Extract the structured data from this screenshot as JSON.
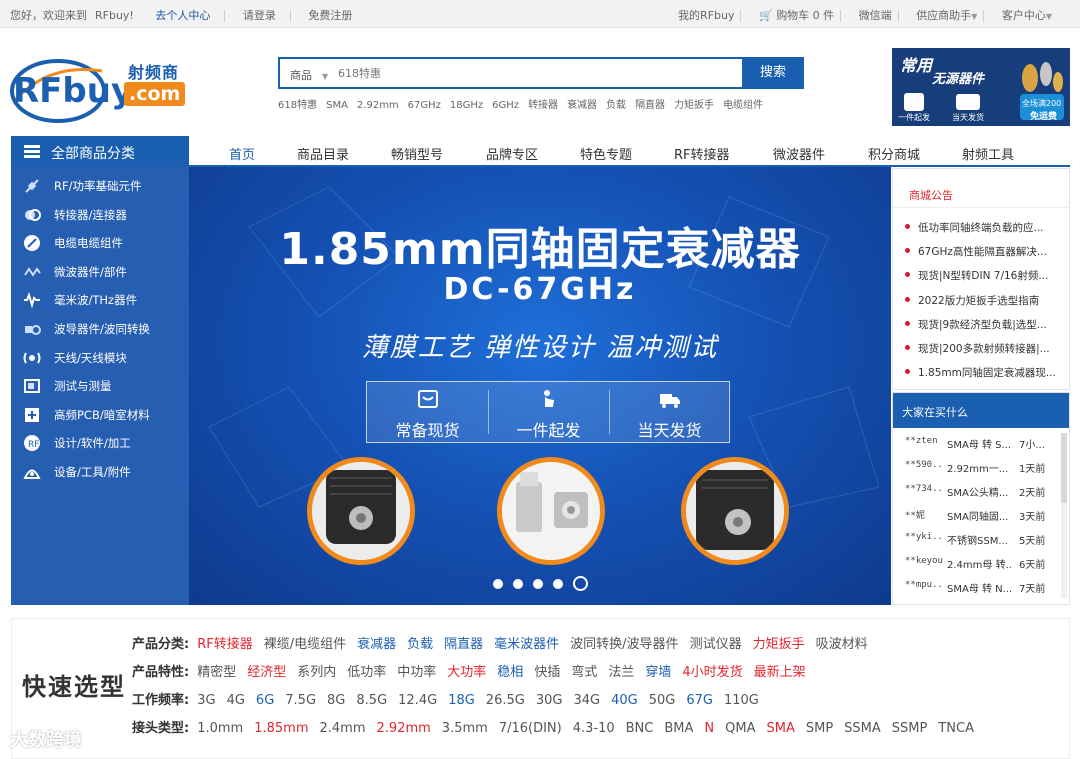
{
  "topbar": {
    "greeting": "您好，欢迎来到",
    "brand": "RFbuy!",
    "personal_center": "去个人中心",
    "login": "请登录",
    "register": "免费注册",
    "my_rfbuy": "我的RFbuy",
    "cart": "购物车 0 件",
    "wechat": "微信端",
    "supplier": "供应商助手",
    "customer_center": "客户中心"
  },
  "logo": {
    "main": "RFbuy",
    "com": ".com",
    "cn": "射频商城"
  },
  "search": {
    "category": "商品",
    "placeholder": "618特惠",
    "button": "搜索",
    "hotwords": [
      "618特惠",
      "SMA",
      "2.92mm",
      "67GHz",
      "18GHz",
      "6GHz",
      "转接器",
      "衰减器",
      "负载",
      "隔直器",
      "力矩扳手",
      "电缆组件"
    ]
  },
  "ad": {
    "line1": "常用",
    "line2": "无源器件",
    "badge1": "一件起发",
    "badge2": "当天发货",
    "promo1": "全场满200",
    "promo2": "免运费"
  },
  "catnav_label": "全部商品分类",
  "mainnav": [
    "首页",
    "商品目录",
    "畅销型号",
    "品牌专区",
    "特色专题",
    "RF转接器",
    "微波器件",
    "积分商城",
    "射频工具"
  ],
  "sidebar": [
    {
      "label": "RF/功率基础元件",
      "icon": "resistor-icon"
    },
    {
      "label": "转接器/连接器",
      "icon": "connector-icon"
    },
    {
      "label": "电缆电缆组件",
      "icon": "cable-icon"
    },
    {
      "label": "微波器件/部件",
      "icon": "microwave-icon"
    },
    {
      "label": "毫米波/THz器件",
      "icon": "wave-icon"
    },
    {
      "label": "波导器件/波同转换",
      "icon": "waveguide-icon"
    },
    {
      "label": "天线/天线模块",
      "icon": "antenna-icon"
    },
    {
      "label": "测试与测量",
      "icon": "instrument-icon"
    },
    {
      "label": "高频PCB/暗室材料",
      "icon": "pcb-icon"
    },
    {
      "label": "设计/软件/加工",
      "icon": "design-icon"
    },
    {
      "label": "设备/工具/附件",
      "icon": "tool-icon"
    }
  ],
  "banner": {
    "title": "1.85mm同轴固定衰减器",
    "freq": "DC-67GHz",
    "slogan": "薄膜工艺  弹性设计  温冲测试",
    "features": [
      "常备现货",
      "一件起发",
      "当天发货"
    ],
    "slides": 5,
    "active_slide": 5
  },
  "notice": {
    "title": "商城公告",
    "items": [
      "低功率同轴终端负载的应...",
      "67GHz高性能隔直器解决...",
      "现货|N型转DIN 7/16射频...",
      "2022版力矩扳手选型指南",
      "现货|9款经济型负载|选型...",
      "现货|200多款射频转接器|...",
      "1.85mm同轴固定衰减器现..."
    ]
  },
  "buying": {
    "title": "大家在买什么",
    "rows": [
      {
        "user": "**zten",
        "product": "SMA母 转 S...",
        "time": "7小..."
      },
      {
        "user": "**590...",
        "product": "2.92mm一...",
        "time": "1天前"
      },
      {
        "user": "**734...",
        "product": "SMA公头精...",
        "time": "2天前"
      },
      {
        "user": "**妮",
        "product": "SMA同轴固...",
        "time": "3天前"
      },
      {
        "user": "**yki...",
        "product": "不锈钢SSM...",
        "time": "5天前"
      },
      {
        "user": "**keyou",
        "product": "2.4mm母 转...",
        "time": "6天前"
      },
      {
        "user": "**mpu...",
        "product": "SMA母 转 N...",
        "time": "7天前"
      }
    ]
  },
  "quick": {
    "title": "快速选型",
    "rows": [
      {
        "label": "产品分类:",
        "items": [
          {
            "t": "RF转接器",
            "c": "red"
          },
          {
            "t": "裸缆/电缆组件",
            "c": ""
          },
          {
            "t": "衰减器",
            "c": "blue"
          },
          {
            "t": "负载",
            "c": "blue"
          },
          {
            "t": "隔直器",
            "c": "blue"
          },
          {
            "t": "毫米波器件",
            "c": "blue"
          },
          {
            "t": "波同转换/波导器件",
            "c": ""
          },
          {
            "t": "测试仪器",
            "c": ""
          },
          {
            "t": "力矩扳手",
            "c": "red"
          },
          {
            "t": "吸波材料",
            "c": ""
          }
        ]
      },
      {
        "label": "产品特性:",
        "items": [
          {
            "t": "精密型",
            "c": ""
          },
          {
            "t": "经济型",
            "c": "red"
          },
          {
            "t": "系列内",
            "c": ""
          },
          {
            "t": "低功率",
            "c": ""
          },
          {
            "t": "中功率",
            "c": ""
          },
          {
            "t": "大功率",
            "c": "red"
          },
          {
            "t": "稳相",
            "c": "blue"
          },
          {
            "t": "快插",
            "c": ""
          },
          {
            "t": "弯式",
            "c": ""
          },
          {
            "t": "法兰",
            "c": ""
          },
          {
            "t": "穿墙",
            "c": "blue"
          },
          {
            "t": "4小时发货",
            "c": "red"
          },
          {
            "t": "最新上架",
            "c": "red"
          }
        ]
      },
      {
        "label": "工作频率:",
        "items": [
          {
            "t": "3G",
            "c": ""
          },
          {
            "t": "4G",
            "c": ""
          },
          {
            "t": "6G",
            "c": "blue"
          },
          {
            "t": "7.5G",
            "c": ""
          },
          {
            "t": "8G",
            "c": ""
          },
          {
            "t": "8.5G",
            "c": ""
          },
          {
            "t": "12.4G",
            "c": ""
          },
          {
            "t": "18G",
            "c": "blue"
          },
          {
            "t": "26.5G",
            "c": ""
          },
          {
            "t": "30G",
            "c": ""
          },
          {
            "t": "34G",
            "c": ""
          },
          {
            "t": "40G",
            "c": "blue"
          },
          {
            "t": "50G",
            "c": ""
          },
          {
            "t": "67G",
            "c": "blue"
          },
          {
            "t": "110G",
            "c": ""
          }
        ]
      },
      {
        "label": "接头类型:",
        "items": [
          {
            "t": "1.0mm",
            "c": ""
          },
          {
            "t": "1.85mm",
            "c": "red"
          },
          {
            "t": "2.4mm",
            "c": ""
          },
          {
            "t": "2.92mm",
            "c": "red"
          },
          {
            "t": "3.5mm",
            "c": ""
          },
          {
            "t": "7/16(DIN)",
            "c": ""
          },
          {
            "t": "4.3-10",
            "c": ""
          },
          {
            "t": "BNC",
            "c": ""
          },
          {
            "t": "BMA",
            "c": ""
          },
          {
            "t": "N",
            "c": "red"
          },
          {
            "t": "QMA",
            "c": ""
          },
          {
            "t": "SMA",
            "c": "red"
          },
          {
            "t": "SMP",
            "c": ""
          },
          {
            "t": "SSMA",
            "c": ""
          },
          {
            "t": "SSMP",
            "c": ""
          },
          {
            "t": "TNCA",
            "c": ""
          }
        ]
      }
    ]
  },
  "watermark": "大数跨境",
  "colors": {
    "brand_blue": "#1b5fb0",
    "accent_red": "#e0262e",
    "accent_orange": "#f08a1c"
  }
}
